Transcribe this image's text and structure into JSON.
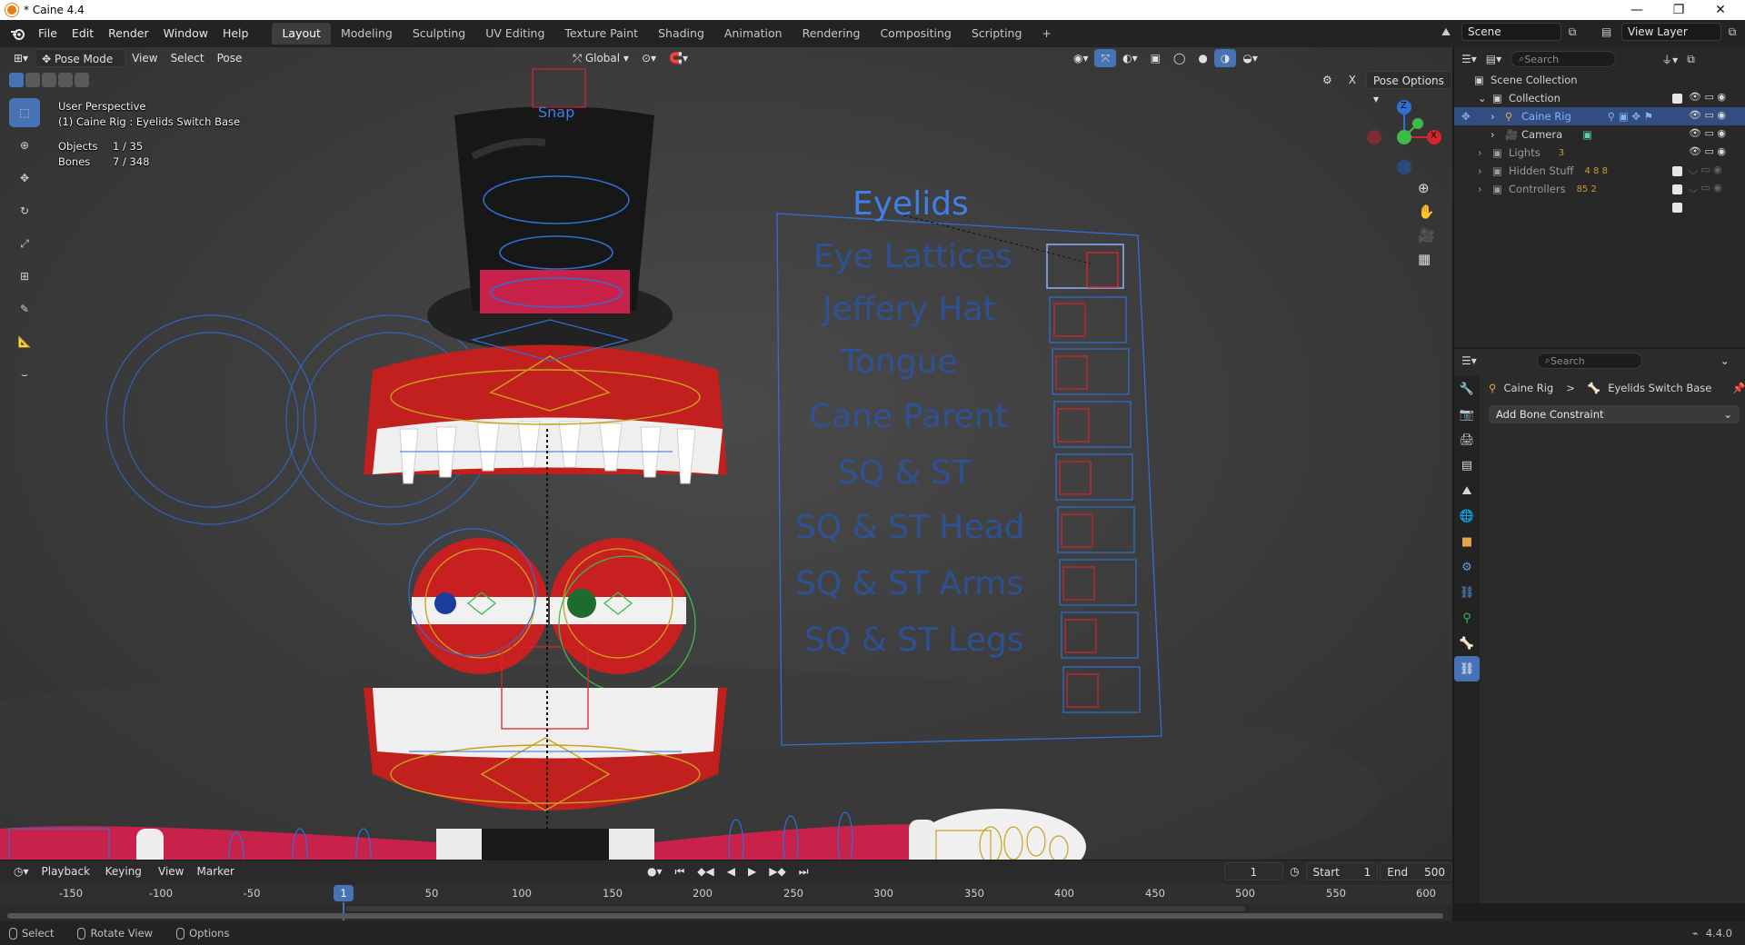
{
  "window": {
    "title": "* Caine 4.4",
    "controls": [
      "—",
      "❐",
      "✕"
    ]
  },
  "menubar": {
    "menus": [
      "File",
      "Edit",
      "Render",
      "Window",
      "Help"
    ],
    "workspaces": [
      "Layout",
      "Modeling",
      "Sculpting",
      "UV Editing",
      "Texture Paint",
      "Shading",
      "Animation",
      "Rendering",
      "Compositing",
      "Scripting"
    ],
    "active_workspace": "Layout",
    "add_tab": "+",
    "scene": "Scene",
    "view_layer": "View Layer"
  },
  "viewport": {
    "header": {
      "mode": "Pose Mode",
      "menus": [
        "View",
        "Select",
        "Pose"
      ],
      "orientation": "Global",
      "pose_options": "Pose Options",
      "x_label": "X"
    },
    "info": {
      "perspective": "User Perspective",
      "active": "(1) Caine Rig : Eyelids Switch Base",
      "objects_label": "Objects",
      "objects_value": "1 / 35",
      "bones_label": "Bones",
      "bones_value": "7 / 348"
    },
    "scene_labels": {
      "snap": "Snap",
      "switches": [
        "Eyelids",
        "Eye Lattices",
        "Jeffery Hat",
        "Tongue",
        "Cane Parent",
        "SQ & ST",
        "SQ & ST Head",
        "SQ & ST Arms",
        "SQ & ST Legs"
      ]
    },
    "gizmo": {
      "z": "Z",
      "y": "Y",
      "x": "X"
    },
    "colors": {
      "bone_blue": "#2f6fd6",
      "bone_yellow": "#c8a21a",
      "bone_green": "#3dbb4a",
      "bone_red": "#d4252d",
      "accent": "#4772b3"
    }
  },
  "outliner": {
    "search_placeholder": "Search",
    "root": "Scene Collection",
    "items": [
      {
        "name": "Collection",
        "level": 1
      },
      {
        "name": "Caine Rig",
        "level": 2,
        "selected": true
      },
      {
        "name": "Camera",
        "level": 2
      },
      {
        "name": "Lights",
        "level": 1,
        "badge": "3"
      },
      {
        "name": "Hidden Stuff",
        "level": 1,
        "badge": "4  8  8"
      },
      {
        "name": "Controllers",
        "level": 1,
        "badge": "85  2"
      }
    ]
  },
  "properties": {
    "search_placeholder": "Search",
    "breadcrumb_object": "Caine Rig",
    "breadcrumb_sep": ">",
    "breadcrumb_bone": "Eyelids Switch Base",
    "add_constraint": "Add Bone Constraint"
  },
  "timeline": {
    "menus": [
      "Playback",
      "Keying",
      "View",
      "Marker"
    ],
    "current_frame": "1",
    "start_label": "Start",
    "start": "1",
    "end_label": "End",
    "end": "500",
    "ticks": [
      "-150",
      "-100",
      "-50",
      "50",
      "100",
      "150",
      "200",
      "250",
      "300",
      "350",
      "400",
      "450",
      "500",
      "550",
      "600"
    ],
    "playhead": "1"
  },
  "statusbar": {
    "select": "Select",
    "rotate": "Rotate View",
    "options": "Options",
    "version": "4.4.0"
  }
}
